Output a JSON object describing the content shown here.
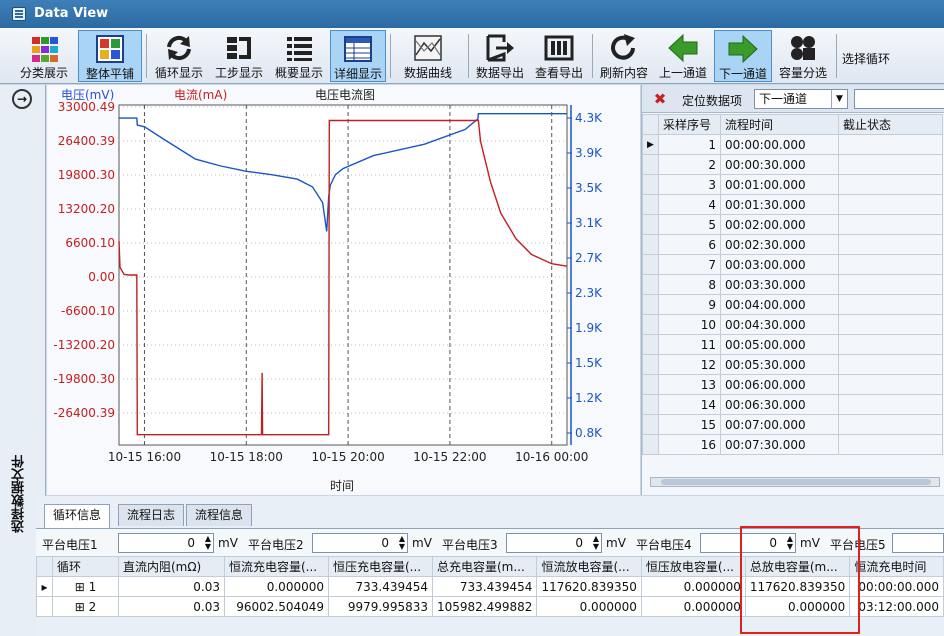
{
  "window": {
    "title": "Data View"
  },
  "toolbar": {
    "buttons": [
      {
        "label": "分类展示",
        "icon": "color-grid-icon"
      },
      {
        "label": "整体平铺",
        "icon": "tile-grid-icon"
      },
      {
        "label": "循环显示",
        "icon": "cycle-icon"
      },
      {
        "label": "工步显示",
        "icon": "step-icon"
      },
      {
        "label": "概要显示",
        "icon": "summary-list-icon"
      },
      {
        "label": "详细显示",
        "icon": "detail-table-icon"
      },
      {
        "label": "数据曲线",
        "icon": "data-curve-icon"
      },
      {
        "label": "数据导出",
        "icon": "export-icon"
      },
      {
        "label": "查看导出",
        "icon": "view-export-icon"
      },
      {
        "label": "刷新内容",
        "icon": "refresh-icon"
      },
      {
        "label": "上一通道",
        "icon": "arrow-left-icon"
      },
      {
        "label": "下一通道",
        "icon": "arrow-right-icon"
      },
      {
        "label": "容量分选",
        "icon": "capacity-sort-icon"
      }
    ],
    "extra_label": "选择循环"
  },
  "left_strip": {
    "label": "选择数据文件"
  },
  "chart_data": {
    "type": "line",
    "title": "电压电流图",
    "ylabel": "电压(mV)",
    "ylabel2": "电流(mA)",
    "xlabel": "时间",
    "y_ticks": [
      "33000.49",
      "26400.39",
      "19800.30",
      "13200.20",
      "6600.10",
      "0.00",
      "-6600.10",
      "-13200.20",
      "-19800.30",
      "-26400.39"
    ],
    "y_range": [
      -33000.49,
      33000.49
    ],
    "y2_ticks": [
      "4.3K",
      "3.9K",
      "3.5K",
      "3.1K",
      "2.7K",
      "2.3K",
      "1.9K",
      "1.5K",
      "1.2K",
      "0.8K"
    ],
    "y2_range": [
      0.4,
      4.3
    ],
    "x_ticks": [
      "10-15 16:00",
      "10-15 18:00",
      "10-15 20:00",
      "10-15 22:00",
      "10-16 00:00"
    ],
    "x_range_hours": [
      15.5,
      24.3
    ],
    "series": [
      {
        "color": "#1a55c8",
        "axis": "right",
        "x": [
          15.5,
          15.85,
          15.86,
          16.0,
          16.4,
          17.0,
          17.5,
          18.0,
          18.5,
          19.0,
          19.3,
          19.5,
          19.58,
          19.62,
          19.65,
          19.75,
          19.9,
          20.5,
          21.5,
          22.3,
          22.55,
          22.56,
          22.6,
          23.0,
          23.5,
          24.0,
          24.3
        ],
        "y": [
          4.15,
          4.15,
          4.07,
          4.05,
          3.9,
          3.68,
          3.6,
          3.54,
          3.5,
          3.45,
          3.36,
          3.18,
          2.85,
          3.25,
          3.38,
          3.5,
          3.57,
          3.72,
          3.85,
          4.02,
          4.14,
          4.2,
          4.2,
          4.2,
          4.2,
          4.2,
          4.2
        ]
      },
      {
        "color": "#c21f1f",
        "axis": "left",
        "x": [
          15.5,
          15.52,
          15.6,
          15.7,
          15.8,
          15.85,
          15.86,
          16.0,
          17.0,
          18.0,
          18.3,
          18.31,
          18.32,
          18.33,
          18.5,
          19.0,
          19.62,
          19.63,
          19.7,
          20.0,
          21.0,
          22.0,
          22.55,
          22.56,
          22.6,
          22.8,
          23.0,
          23.3,
          23.6,
          24.0,
          24.3
        ],
        "y": [
          6600,
          1500,
          100,
          0,
          0,
          0,
          -31000,
          -31000,
          -31000,
          -31000,
          -31000,
          -19000,
          -31000,
          -31000,
          -31000,
          -31000,
          -31000,
          30000,
          30000,
          30000,
          30000,
          30000,
          30000,
          30000,
          26000,
          18000,
          12000,
          7000,
          4000,
          2200,
          1700
        ]
      }
    ]
  },
  "seq_grid": {
    "toolbar_label": "定位数据项",
    "select_value": "下一通道",
    "headers": [
      "采样序号",
      "流程时间",
      "截止状态"
    ],
    "rows": [
      [
        "1",
        "00:00:00.000",
        ""
      ],
      [
        "2",
        "00:00:30.000",
        ""
      ],
      [
        "3",
        "00:01:00.000",
        ""
      ],
      [
        "4",
        "00:01:30.000",
        ""
      ],
      [
        "5",
        "00:02:00.000",
        ""
      ],
      [
        "6",
        "00:02:30.000",
        ""
      ],
      [
        "7",
        "00:03:00.000",
        ""
      ],
      [
        "8",
        "00:03:30.000",
        ""
      ],
      [
        "9",
        "00:04:00.000",
        ""
      ],
      [
        "10",
        "00:04:30.000",
        ""
      ],
      [
        "11",
        "00:05:00.000",
        ""
      ],
      [
        "12",
        "00:05:30.000",
        ""
      ],
      [
        "13",
        "00:06:00.000",
        ""
      ],
      [
        "14",
        "00:06:30.000",
        ""
      ],
      [
        "15",
        "00:07:00.000",
        ""
      ],
      [
        "16",
        "00:07:30.000",
        ""
      ]
    ]
  },
  "bottom": {
    "tabs": [
      "循环信息",
      "流程日志",
      "流程信息"
    ],
    "platform": {
      "labels": [
        "平台电压1",
        "平台电压2",
        "平台电压3",
        "平台电压4",
        "平台电压5"
      ],
      "values": [
        "0",
        "0",
        "0",
        "0"
      ],
      "unit": "mV"
    },
    "cycle_headers": [
      "循环",
      "直流内阻(mΩ)",
      "恒流充电容量(...",
      "恒压充电容量(...",
      "总充电容量(m...",
      "恒流放电容量(...",
      "恒压放电容量(...",
      "总放电容量(m...",
      "恒流充电时间"
    ],
    "cycle_rows": [
      [
        "1",
        "0.03",
        "0.000000",
        "733.439454",
        "733.439454",
        "117620.839350",
        "0.000000",
        "117620.839350",
        "00:00:00.000"
      ],
      [
        "2",
        "0.03",
        "96002.504049",
        "9979.995833",
        "105982.499882",
        "0.000000",
        "0.000000",
        "0.000000",
        "03:12:00.000"
      ]
    ]
  }
}
